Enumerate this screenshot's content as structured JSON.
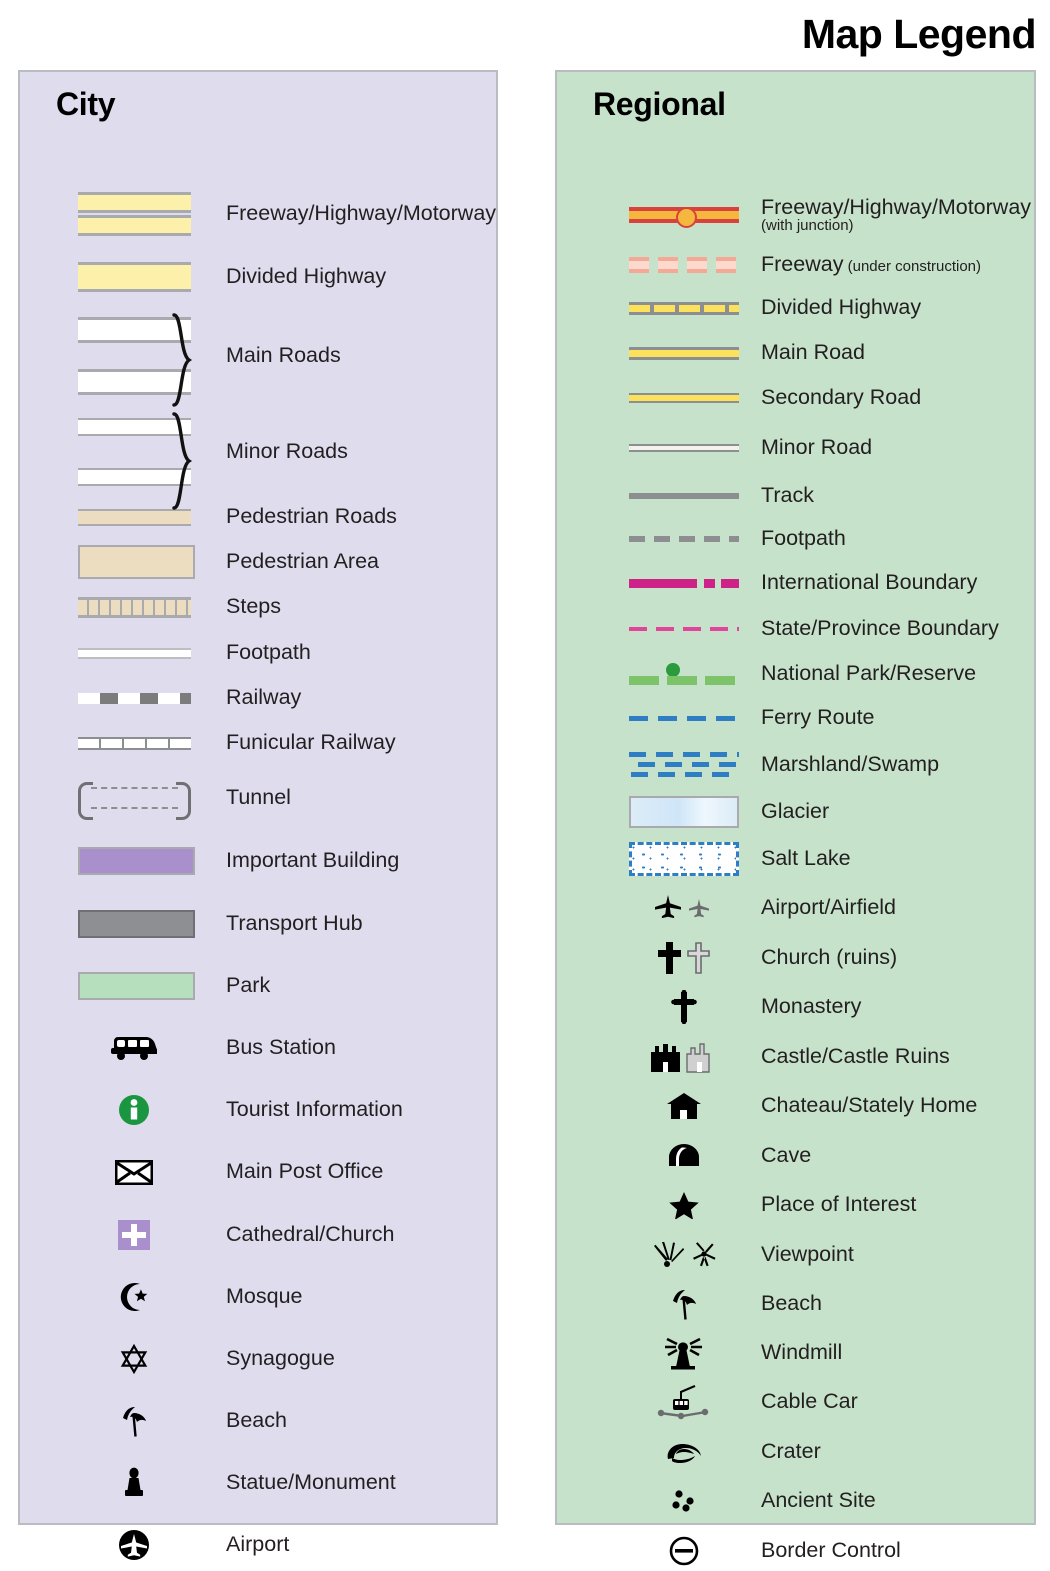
{
  "title": "Map Legend",
  "panels": {
    "city": {
      "heading": "City",
      "bg_color": "#dedced",
      "items": [
        {
          "label": "Freeway/Highway/Motorway",
          "symbol": "freeway-double-band"
        },
        {
          "label": "Divided Highway",
          "symbol": "divided-highway-band"
        },
        {
          "label": "Main Roads",
          "symbol": "white-road-pair-braced"
        },
        {
          "label": "Minor Roads",
          "symbol": "white-road-pair-thin-braced"
        },
        {
          "label": "Pedestrian Roads",
          "symbol": "pedestrian-road-band"
        },
        {
          "label": "Pedestrian Area",
          "symbol": "pedestrian-area-block"
        },
        {
          "label": "Steps",
          "symbol": "steps-segmented-band"
        },
        {
          "label": "Footpath",
          "symbol": "footpath-thin-line"
        },
        {
          "label": "Railway",
          "symbol": "railway-hatched-line"
        },
        {
          "label": "Funicular Railway",
          "symbol": "funicular-ticked-line"
        },
        {
          "label": "Tunnel",
          "symbol": "tunnel-dashed-portal"
        },
        {
          "label": "Important Building",
          "symbol": "important-building-swatch"
        },
        {
          "label": "Transport Hub",
          "symbol": "transport-hub-swatch"
        },
        {
          "label": "Park",
          "symbol": "park-swatch"
        },
        {
          "label": "Bus Station",
          "symbol": "bus-icon"
        },
        {
          "label": "Tourist Information",
          "symbol": "information-circle-icon"
        },
        {
          "label": "Main Post Office",
          "symbol": "envelope-icon"
        },
        {
          "label": "Cathedral/Church",
          "symbol": "cathedral-cross-square-icon"
        },
        {
          "label": "Mosque",
          "symbol": "crescent-star-icon"
        },
        {
          "label": "Synagogue",
          "symbol": "star-of-david-icon"
        },
        {
          "label": "Beach",
          "symbol": "beach-umbrella-icon"
        },
        {
          "label": "Statue/Monument",
          "symbol": "statue-icon"
        },
        {
          "label": "Airport",
          "symbol": "airport-circle-icon"
        }
      ]
    },
    "regional": {
      "heading": "Regional",
      "bg_color": "#c6e2ca",
      "items": [
        {
          "label": "Freeway/Highway/Motorway",
          "sublabel": "(with junction)",
          "sub_below": true,
          "symbol": "freeway-junction-line"
        },
        {
          "label": "Freeway",
          "sublabel": "(under construction)",
          "symbol": "freeway-under-construction-line"
        },
        {
          "label": "Divided Highway",
          "symbol": "divided-highway-line"
        },
        {
          "label": "Main Road",
          "symbol": "main-road-line"
        },
        {
          "label": "Secondary Road",
          "symbol": "secondary-road-line"
        },
        {
          "label": "Minor Road",
          "symbol": "minor-road-line"
        },
        {
          "label": "Track",
          "symbol": "track-line"
        },
        {
          "label": "Footpath",
          "symbol": "footpath-dashed-line"
        },
        {
          "label": "International Boundary",
          "symbol": "international-boundary-line"
        },
        {
          "label": "State/Province Boundary",
          "symbol": "state-boundary-line"
        },
        {
          "label": "National Park/Reserve",
          "symbol": "national-park-line"
        },
        {
          "label": "Ferry Route",
          "symbol": "ferry-route-line"
        },
        {
          "label": "Marshland/Swamp",
          "symbol": "marshland-pattern"
        },
        {
          "label": "Glacier",
          "symbol": "glacier-swatch"
        },
        {
          "label": "Salt Lake",
          "symbol": "salt-lake-swatch"
        },
        {
          "label": "Airport/Airfield",
          "symbol": "airplane-pair-icon"
        },
        {
          "label": "Church (ruins)",
          "symbol": "cross-pair-icon"
        },
        {
          "label": "Monastery",
          "symbol": "monastery-cross-icon"
        },
        {
          "label": "Castle/Castle Ruins",
          "symbol": "castle-pair-icon"
        },
        {
          "label": "Chateau/Stately Home",
          "symbol": "chateau-icon"
        },
        {
          "label": "Cave",
          "symbol": "cave-icon"
        },
        {
          "label": "Place of Interest",
          "symbol": "star-icon"
        },
        {
          "label": "Viewpoint",
          "symbol": "viewpoint-pair-icon"
        },
        {
          "label": "Beach",
          "symbol": "beach-umbrella-icon"
        },
        {
          "label": "Windmill",
          "symbol": "windmill-icon"
        },
        {
          "label": "Cable Car",
          "symbol": "cable-car-icon"
        },
        {
          "label": "Crater",
          "symbol": "crater-icon"
        },
        {
          "label": "Ancient Site",
          "symbol": "ancient-site-dots-icon"
        },
        {
          "label": "Border Control",
          "symbol": "border-control-icon"
        }
      ]
    }
  },
  "colors": {
    "city_bg": "#dedced",
    "regional_bg": "#c6e2ca",
    "highway_yellow": "#fdf0ab",
    "road_yellow": "#fbe15c",
    "freeway_red": "#d9423c",
    "freeway_orange": "#f5b73d",
    "pedestrian_tan": "#ecdcc0",
    "important_building": "#a98fcc",
    "transport_hub": "#8e8f93",
    "park_green": "#b6dfbd",
    "boundary_magenta": "#cd2287",
    "state_boundary": "#e0449b",
    "park_line_green": "#7dc36a",
    "water_blue": "#2f7ec4",
    "info_green": "#1a9641",
    "border_gray": "#b9bcc0"
  }
}
